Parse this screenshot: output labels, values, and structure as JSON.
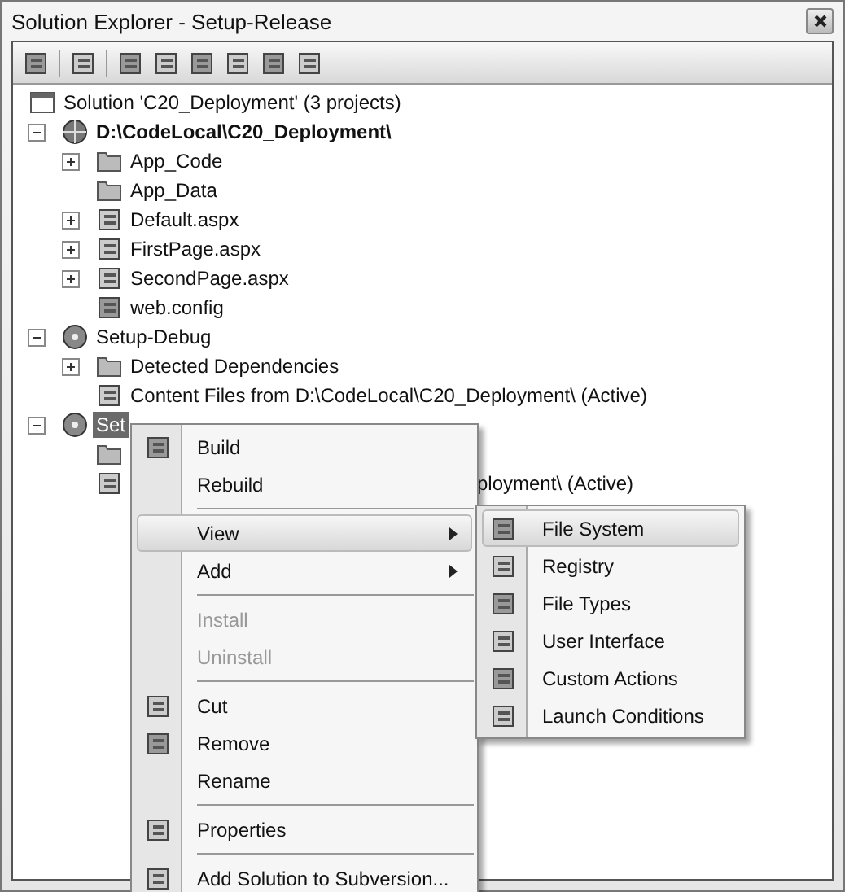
{
  "window": {
    "title": "Solution Explorer - Setup-Release"
  },
  "tree": [
    {
      "label": "Solution 'C20_Deployment' (3 projects)",
      "kind": "solution",
      "bold": false,
      "selected": false,
      "children": [
        {
          "label": "D:\\CodeLocal\\C20_Deployment\\",
          "kind": "website",
          "bold": true,
          "selected": false,
          "expanded": true,
          "children": [
            {
              "label": "App_Code",
              "kind": "folder",
              "bold": false,
              "selected": false,
              "expanded": false
            },
            {
              "label": "App_Data",
              "kind": "folder",
              "bold": false,
              "selected": false
            },
            {
              "label": "Default.aspx",
              "kind": "page",
              "bold": false,
              "selected": false,
              "expanded": false
            },
            {
              "label": "FirstPage.aspx",
              "kind": "page",
              "bold": false,
              "selected": false,
              "expanded": false
            },
            {
              "label": "SecondPage.aspx",
              "kind": "page",
              "bold": false,
              "selected": false,
              "expanded": false
            },
            {
              "label": "web.config",
              "kind": "config",
              "bold": false,
              "selected": false
            }
          ]
        },
        {
          "label": "Setup-Debug",
          "kind": "setup",
          "bold": false,
          "selected": false,
          "expanded": true,
          "children": [
            {
              "label": "Detected Dependencies",
              "kind": "folder",
              "bold": false,
              "selected": false,
              "expanded": false
            },
            {
              "label": "Content Files from D:\\CodeLocal\\C20_Deployment\\ (Active)",
              "kind": "content",
              "bold": false,
              "selected": false
            }
          ]
        },
        {
          "label": "Set",
          "kind": "setup",
          "bold": false,
          "selected": true,
          "expanded": true,
          "children": [
            {
              "kind": "folder"
            },
            {
              "label": "ployment\\ (Active)",
              "kind": "content",
              "bold": false,
              "selected": false,
              "partial": true
            }
          ]
        }
      ]
    }
  ],
  "context_menu": [
    {
      "kind": "item",
      "label": "Build",
      "icon": true,
      "disabled": false,
      "selected": false,
      "submenu": false
    },
    {
      "kind": "item",
      "label": "Rebuild",
      "icon": false,
      "disabled": false,
      "selected": false,
      "submenu": false
    },
    {
      "kind": "separator"
    },
    {
      "kind": "item",
      "label": "View",
      "icon": false,
      "disabled": false,
      "selected": true,
      "submenu": true
    },
    {
      "kind": "item",
      "label": "Add",
      "icon": false,
      "disabled": false,
      "selected": false,
      "submenu": true
    },
    {
      "kind": "separator"
    },
    {
      "kind": "item",
      "label": "Install",
      "icon": false,
      "disabled": true,
      "selected": false,
      "submenu": false
    },
    {
      "kind": "item",
      "label": "Uninstall",
      "icon": false,
      "disabled": true,
      "selected": false,
      "submenu": false
    },
    {
      "kind": "separator"
    },
    {
      "kind": "item",
      "label": "Cut",
      "icon": true,
      "disabled": false,
      "selected": false,
      "submenu": false
    },
    {
      "kind": "item",
      "label": "Remove",
      "icon": true,
      "disabled": false,
      "selected": false,
      "submenu": false
    },
    {
      "kind": "item",
      "label": "Rename",
      "icon": false,
      "disabled": false,
      "selected": false,
      "submenu": false
    },
    {
      "kind": "separator"
    },
    {
      "kind": "item",
      "label": "Properties",
      "icon": true,
      "disabled": false,
      "selected": false,
      "submenu": false
    },
    {
      "kind": "separator"
    },
    {
      "kind": "item",
      "label": "Add Solution to Subversion...",
      "icon": true,
      "disabled": false,
      "selected": false,
      "submenu": false
    }
  ],
  "submenu": [
    {
      "label": "File System",
      "selected": true
    },
    {
      "label": "Registry",
      "selected": false
    },
    {
      "label": "File Types",
      "selected": false
    },
    {
      "label": "User Interface",
      "selected": false
    },
    {
      "label": "Custom Actions",
      "selected": false
    },
    {
      "label": "Launch Conditions",
      "selected": false
    }
  ]
}
